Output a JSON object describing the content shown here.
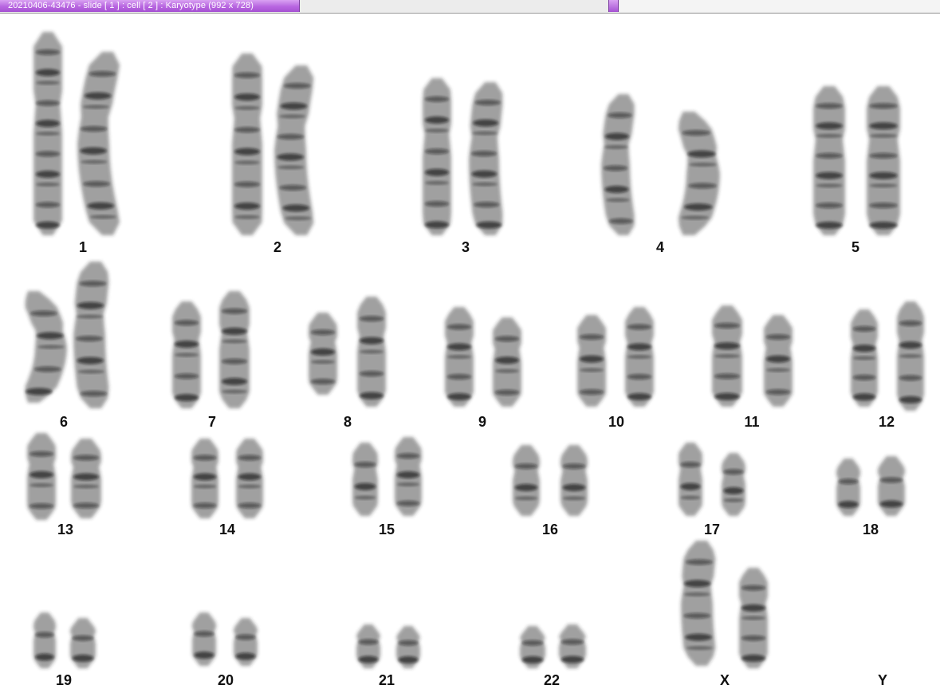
{
  "window": {
    "title": "20210406-43476 - slide [ 1 ] : cell [ 2 ] : Karyotype  (992 x 728)"
  },
  "karyotype": {
    "labels": [
      "1",
      "2",
      "3",
      "4",
      "5",
      "6",
      "7",
      "8",
      "9",
      "10",
      "11",
      "12",
      "13",
      "14",
      "15",
      "16",
      "17",
      "18",
      "19",
      "20",
      "21",
      "22",
      "X",
      "Y"
    ],
    "colors": {
      "chromatin": "#2a2a2a",
      "band": "#0e0e0e",
      "label": "#111111",
      "background": "#ffffff",
      "title_tab": "#b865e0"
    }
  }
}
